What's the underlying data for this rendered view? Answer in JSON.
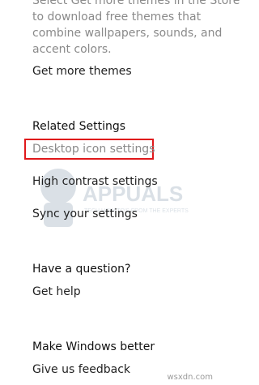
{
  "themes": {
    "description_lines": [
      "Select Get more themes in the Store",
      "to download free themes that",
      "combine wallpapers, sounds, and",
      "accent colors."
    ],
    "get_more_link": "Get more themes"
  },
  "related_settings": {
    "heading": "Related Settings",
    "desktop_icon": "Desktop icon settings",
    "high_contrast": "High contrast settings",
    "sync": "Sync your settings"
  },
  "question": {
    "heading": "Have a question?",
    "get_help": "Get help"
  },
  "better": {
    "heading": "Make Windows better",
    "feedback": "Give us feedback"
  },
  "watermark": {
    "brand": "APPUALS",
    "tagline": "TECH HOW-TO'S FROM THE EXPERTS"
  },
  "footer": {
    "site": "wsxdn.com"
  },
  "colors": {
    "highlight": "#e0181b",
    "muted_text": "#8a8a8a"
  }
}
